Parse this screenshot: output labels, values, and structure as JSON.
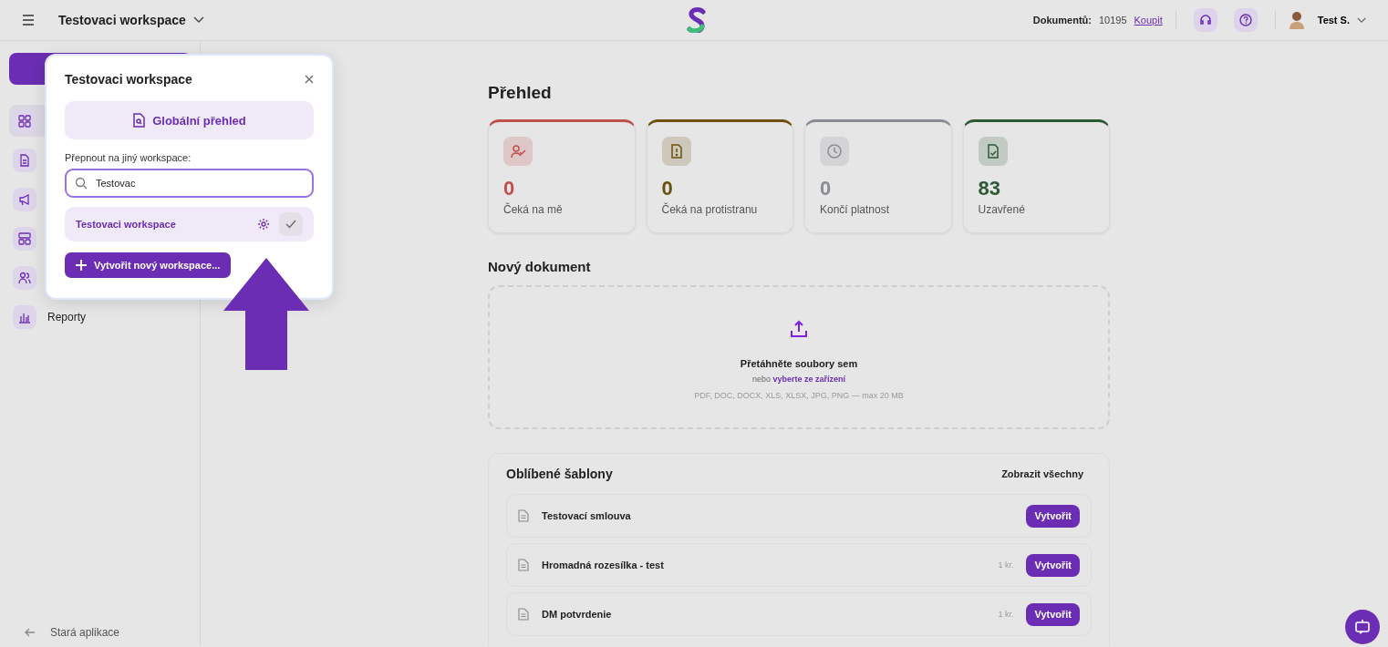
{
  "topbar": {
    "workspace": "Testovaci workspace",
    "documents_label": "Dokumentů:",
    "documents_count": "10195",
    "buy_link": "Koupit",
    "user": "Test S."
  },
  "sidebar": {
    "items": [
      {
        "selected": true
      },
      {
        "selected": false
      },
      {
        "selected": false
      },
      {
        "selected": false
      },
      {
        "selected": false
      },
      {
        "label": "Reporty",
        "selected": false
      }
    ],
    "footer": "Stará aplikace"
  },
  "overview": {
    "title": "Přehled",
    "cards": [
      {
        "value": "0",
        "label": "Čeká na mě",
        "color": "#c0504d"
      },
      {
        "value": "0",
        "label": "Čeká na protistranu",
        "color": "#6b5010"
      },
      {
        "value": "0",
        "label": "Končí platnost",
        "color": "#8a8c94"
      },
      {
        "value": "83",
        "label": "Uzavřené",
        "color": "#2d5a35"
      }
    ]
  },
  "upload": {
    "title": "Nový dokument",
    "drop_text": "Přetáhněte soubory sem",
    "or_text": "nebo",
    "choose_link": "vyberte ze zařízení",
    "formats": "PDF, DOC, DOCX, XLS, XLSX, JPG, PNG — max 20 MB"
  },
  "templates": {
    "title": "Oblíbené šablony",
    "show_all": "Zobrazit všechny",
    "rows": [
      {
        "name": "Testovací smlouva",
        "button": "Vytvořit"
      },
      {
        "name": "Hromadná rozesílka - test",
        "price": "1 kr.",
        "button": "Vytvořit"
      },
      {
        "name": "DM potvrdenie",
        "price": "1 kr.",
        "button": "Vytvořit"
      }
    ]
  },
  "popup": {
    "title": "Testovaci workspace",
    "global_button": "Globální přehled",
    "switch_label": "Přepnout na jiný workspace:",
    "search_value": "Testovac",
    "workspaces": [
      {
        "name": "Testovaci workspace",
        "selected": true
      }
    ],
    "create_button": "Vytvořit nový workspace..."
  }
}
